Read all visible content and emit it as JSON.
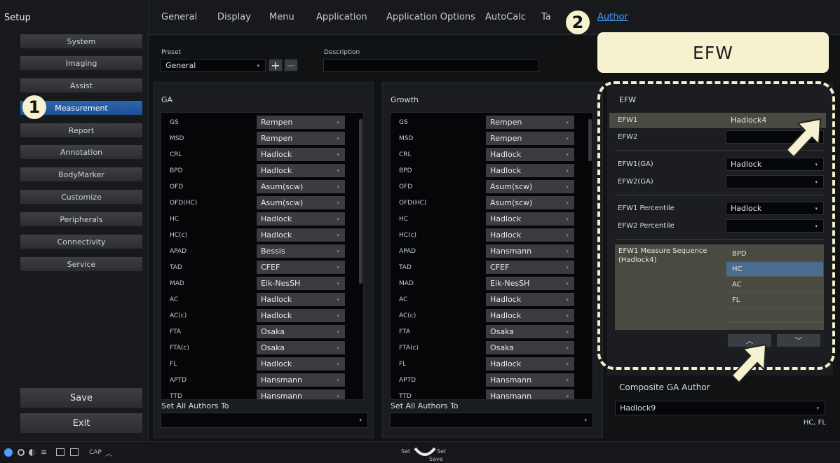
{
  "sidebar": {
    "title": "Setup",
    "items": [
      "System",
      "Imaging",
      "Assist",
      "Measurement",
      "Report",
      "Annotation",
      "BodyMarker",
      "Customize",
      "Peripherals",
      "Connectivity",
      "Service"
    ],
    "save_label": "Save",
    "exit_label": "Exit"
  },
  "badges": {
    "one": "1",
    "two": "2"
  },
  "tabs": [
    "General",
    "Display",
    "Menu",
    "Application",
    "Application Options",
    "AutoCalc",
    "Ta",
    "Author"
  ],
  "preset": {
    "label": "Preset",
    "value": "General",
    "description_label": "Description",
    "description_value": ""
  },
  "ga": {
    "title": "GA",
    "rows": [
      {
        "name": "GS",
        "value": "Rempen"
      },
      {
        "name": "MSD",
        "value": "Rempen"
      },
      {
        "name": "CRL",
        "value": "Hadlock"
      },
      {
        "name": "BPD",
        "value": "Hadlock"
      },
      {
        "name": "OFD",
        "value": "Asum(scw)"
      },
      {
        "name": "OFD(HC)",
        "value": "Asum(scw)"
      },
      {
        "name": "HC",
        "value": "Hadlock"
      },
      {
        "name": "HC(c)",
        "value": "Hadlock"
      },
      {
        "name": "APAD",
        "value": "Bessis"
      },
      {
        "name": "TAD",
        "value": "CFEF"
      },
      {
        "name": "MAD",
        "value": "Eik-NesSH"
      },
      {
        "name": "AC",
        "value": "Hadlock"
      },
      {
        "name": "AC(c)",
        "value": "Hadlock"
      },
      {
        "name": "FTA",
        "value": "Osaka"
      },
      {
        "name": "FTA(c)",
        "value": "Osaka"
      },
      {
        "name": "FL",
        "value": "Hadlock"
      },
      {
        "name": "APTD",
        "value": "Hansmann"
      },
      {
        "name": "TTD",
        "value": "Hansmann"
      }
    ],
    "set_all_label": "Set All Authors To"
  },
  "growth": {
    "title": "Growth",
    "rows": [
      {
        "name": "GS",
        "value": "Rempen"
      },
      {
        "name": "MSD",
        "value": "Rempen"
      },
      {
        "name": "CRL",
        "value": "Hadlock"
      },
      {
        "name": "BPD",
        "value": "Hadlock"
      },
      {
        "name": "OFD",
        "value": "Asum(scw)"
      },
      {
        "name": "OFD(HC)",
        "value": "Asum(scw)"
      },
      {
        "name": "HC",
        "value": "Hadlock"
      },
      {
        "name": "HC(c)",
        "value": "Hadlock"
      },
      {
        "name": "APAD",
        "value": "Hansmann"
      },
      {
        "name": "TAD",
        "value": "CFEF"
      },
      {
        "name": "MAD",
        "value": "Eik-NesSH"
      },
      {
        "name": "AC",
        "value": "Hadlock"
      },
      {
        "name": "AC(c)",
        "value": "Hadlock"
      },
      {
        "name": "FTA",
        "value": "Osaka"
      },
      {
        "name": "FTA(c)",
        "value": "Osaka"
      },
      {
        "name": "FL",
        "value": "Hadlock"
      },
      {
        "name": "APTD",
        "value": "Hansmann"
      },
      {
        "name": "TTD",
        "value": "Hansmann"
      }
    ],
    "set_all_label": "Set All Authors To"
  },
  "efw": {
    "callout": "EFW",
    "title": "EFW",
    "efw1_label": "EFW1",
    "efw1_value": "Hadlock4",
    "efw2_label": "EFW2",
    "efw2_value": "",
    "efw1ga_label": "EFW1(GA)",
    "efw1ga_value": "Hadlock",
    "efw2ga_label": "EFW2(GA)",
    "efw2ga_value": "",
    "efw1pct_label": "EFW1 Percentile",
    "efw1pct_value": "Hadlock",
    "efw2pct_label": "EFW2 Percentile",
    "efw2pct_value": "",
    "seq_label": "EFW1 Measure Sequence (Hadlock4)",
    "sequence": [
      "BPD",
      "HC",
      "AC",
      "FL"
    ],
    "up_glyph": "︿",
    "down_glyph": "﹀"
  },
  "composite": {
    "title": "Composite GA Author",
    "value": "Hadlock9",
    "note": "HC, FL"
  },
  "dropdown_glyph": "▾",
  "bottom": {
    "caps": "CAP",
    "set_left": "Set",
    "set_right": "Set",
    "save": "Save"
  },
  "colors": {
    "accent": "#1f4f8f",
    "callout": "#f6f1cf",
    "active_tab": "#4aa0ff"
  }
}
